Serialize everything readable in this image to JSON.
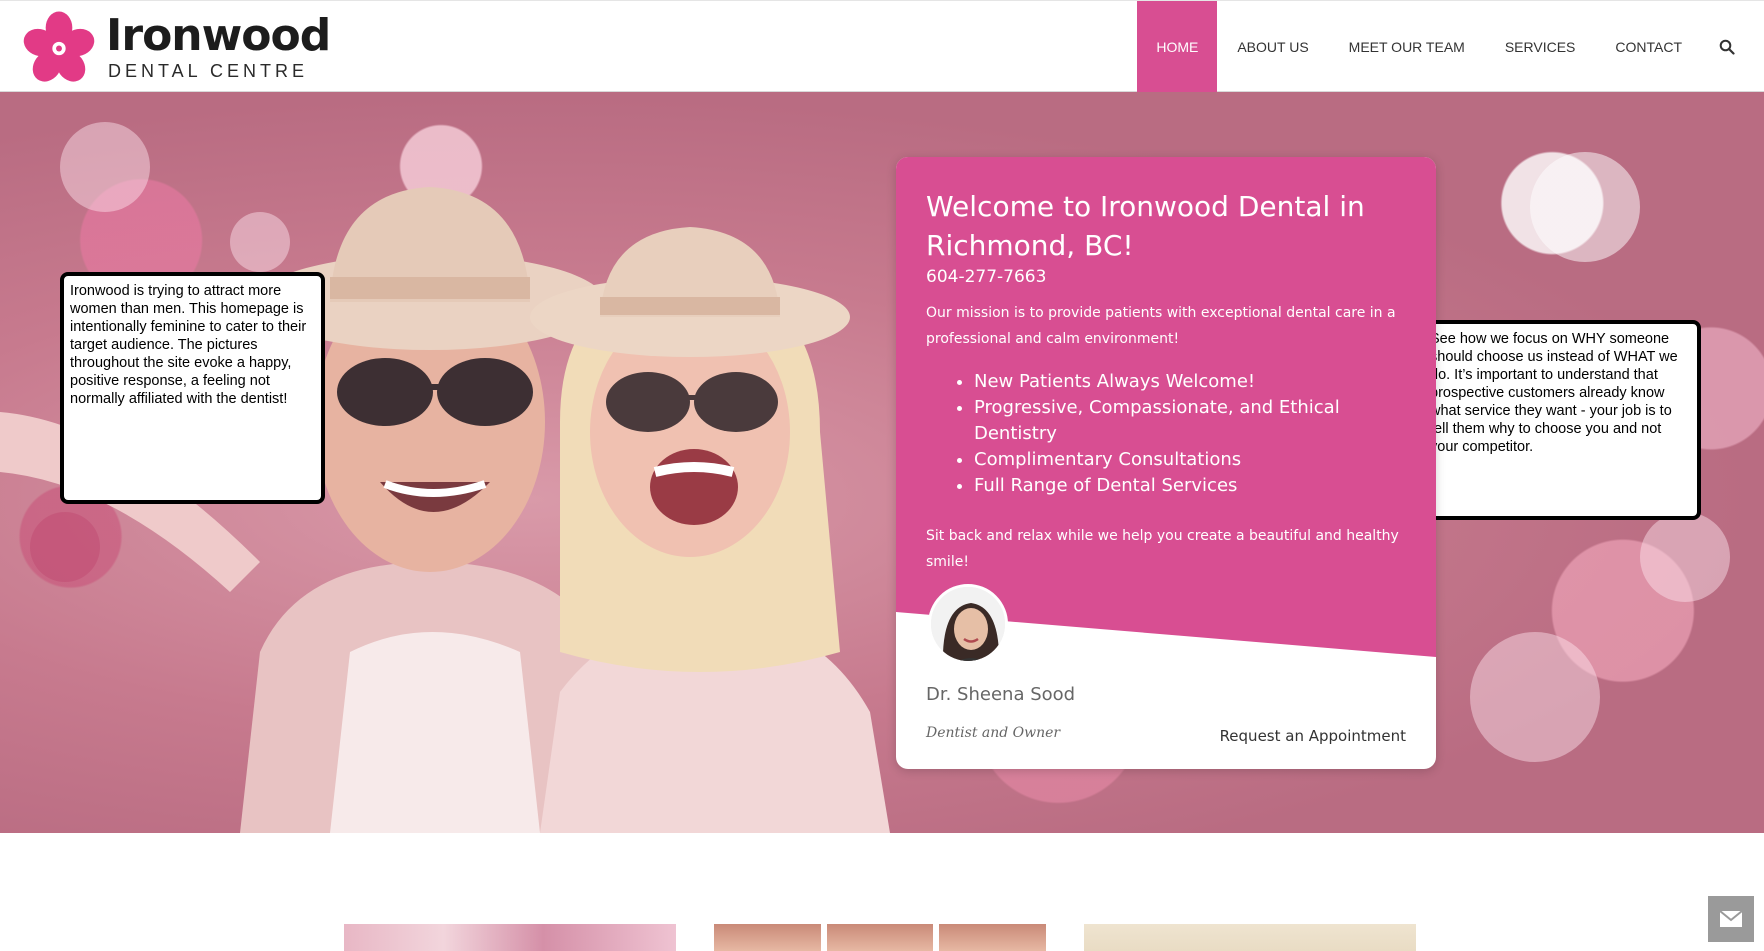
{
  "brand": {
    "name": "Ironwood",
    "tagline": "DENTAL CENTRE"
  },
  "nav": {
    "items": [
      {
        "label": "HOME",
        "active": true
      },
      {
        "label": "ABOUT US",
        "active": false
      },
      {
        "label": "MEET OUR TEAM",
        "active": false
      },
      {
        "label": "SERVICES",
        "active": false
      },
      {
        "label": "CONTACT",
        "active": false
      }
    ],
    "search_icon": "search-icon"
  },
  "card": {
    "title": "Welcome to Ironwood Dental in Richmond, BC!",
    "phone": "604-277-7663",
    "mission": "Our mission is to provide patients with exceptional dental care in a professional and calm environment!",
    "bullets": [
      "New Patients Always Welcome!",
      "Progressive, Compassionate, and Ethical Dentistry",
      "Complimentary Consultations",
      "Full Range of Dental Services"
    ],
    "relax": "Sit back and relax while we help you create a beautiful and healthy smile!",
    "doctor_name": "Dr. Sheena Sood",
    "doctor_role": "Dentist and Owner",
    "cta": "Request an Appointment"
  },
  "annotations": {
    "left": "Ironwood is trying to attract more women than men. This homepage is intentionally feminine to cater to their target audience. The pictures throughout the site evoke a happy, positive response, a feeling not normally affiliated with the dentist!",
    "right": "See how we focus on WHY someone should choose us instead of WHAT we do. It’s important to understand that prospective customers already know what service they want - your job is to tell them why to choose you and not your competitor."
  },
  "colors": {
    "brand_pink": "#d84e92",
    "annotation_arrow": "#22dd22",
    "floating_button": "#9a9a9a"
  },
  "floating_button": {
    "icon": "envelope-icon"
  }
}
